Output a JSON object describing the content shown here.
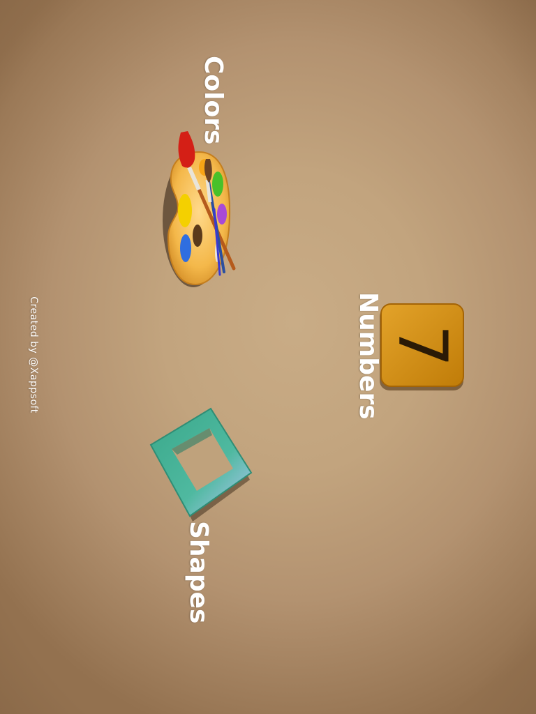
{
  "menu": {
    "colors_label": "Colors",
    "numbers_label": "Numbers",
    "shapes_label": "Shapes"
  },
  "number_tile": {
    "digit": "7"
  },
  "footer": {
    "credit": "Created by @Xappsoft"
  },
  "colors": {
    "background": "#c2a47e",
    "number_tile": "#d18f0e",
    "shape_tile": "#43b39a",
    "label_text": "#ffffff"
  },
  "icons": {
    "colors": "paint-palette-icon",
    "numbers": "number-seven-icon",
    "shapes": "square-frame-icon"
  }
}
